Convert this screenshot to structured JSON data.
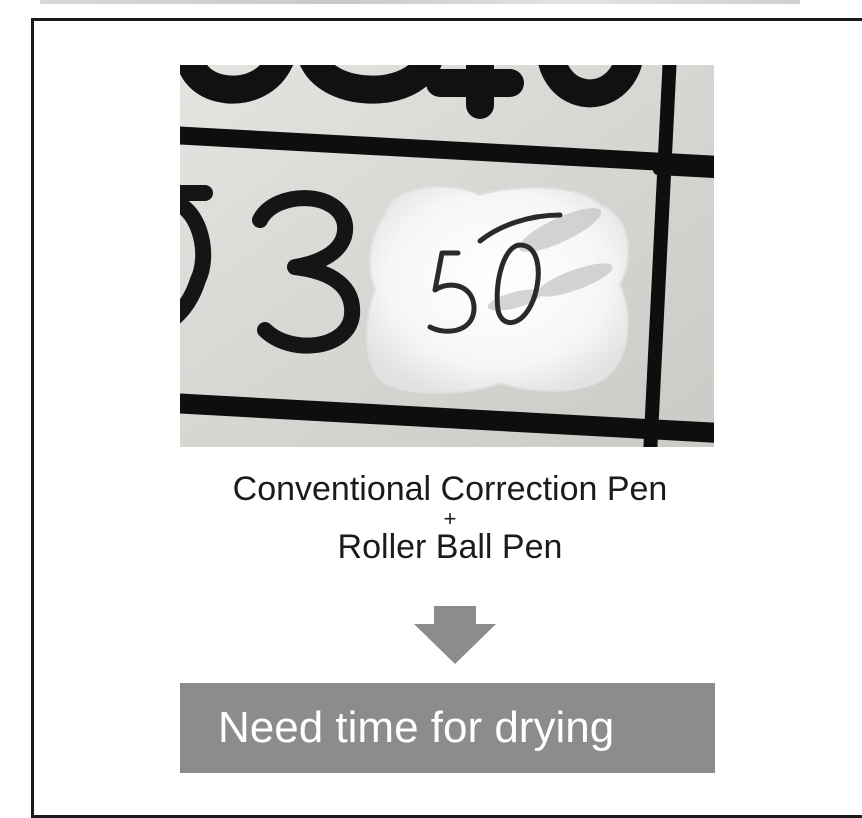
{
  "photo": {
    "printed_digits": "53",
    "handwritten_digits": "50"
  },
  "caption": {
    "line1": "Conventional Correction Pen",
    "plus": "+",
    "line2": "Roller Ball Pen"
  },
  "arrow": {
    "icon": "down-arrow-icon",
    "color": "#8c8c8c"
  },
  "result": {
    "label": "Need time for drying",
    "background": "#8c8c8c"
  }
}
